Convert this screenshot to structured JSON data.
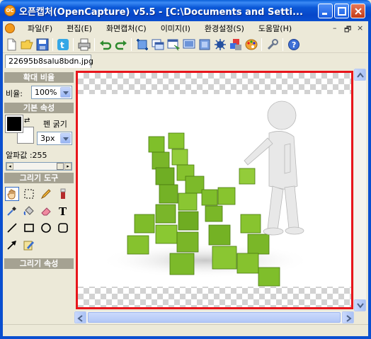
{
  "window": {
    "title": "오픈캡처(OpenCapture) v5.5 - [C:\\Documents and Setti...",
    "app_icon_text": "OC"
  },
  "menu": {
    "items": [
      {
        "label": "파일(F)"
      },
      {
        "label": "편집(E)"
      },
      {
        "label": "화면캡처(C)"
      },
      {
        "label": "이미지(I)"
      },
      {
        "label": "환경설정(S)"
      },
      {
        "label": "도움말(H)"
      }
    ],
    "mdi_controls": [
      "–",
      "🗗",
      "×"
    ]
  },
  "toolbar": {
    "buttons": [
      "new-file-icon",
      "open-folder-icon",
      "save-icon",
      "twitter-icon",
      "print-icon",
      "undo-icon",
      "redo-icon",
      "crop-icon",
      "window-capture-icon",
      "region-capture-icon",
      "fullscreen-capture-icon",
      "blur-icon",
      "effects-icon",
      "color-icon",
      "palette-icon",
      "settings-wrench-icon",
      "help-icon"
    ]
  },
  "document": {
    "tab_label": "22695b8salu8bdn.jpg"
  },
  "left_panel": {
    "zoom_header": "확대 비율",
    "zoom_label": "비율:",
    "zoom_value": "100%",
    "basic_header": "기본 속성",
    "pen_width_label": "펜 굵기",
    "pen_width_value": "3px",
    "alpha_label": "알파값 :255",
    "alpha_value": 255,
    "draw_tools_header": "그리기 도구",
    "draw_props_header": "그리기 속성",
    "tools": [
      "hand-tool-icon",
      "select-rect-icon",
      "pencil-icon",
      "marker-icon",
      "eyedropper-icon",
      "fill-bucket-icon",
      "eraser-icon",
      "text-tool-icon",
      "line-tool-icon",
      "rectangle-tool-icon",
      "ellipse-tool-icon",
      "rounded-rect-tool-icon",
      "arrow-tool-icon",
      "highlighter-icon"
    ]
  },
  "colors": {
    "foreground": "#000000",
    "background": "#ffffff",
    "selection_border": "#e8151b",
    "title_bar": "#0a4fd0"
  }
}
